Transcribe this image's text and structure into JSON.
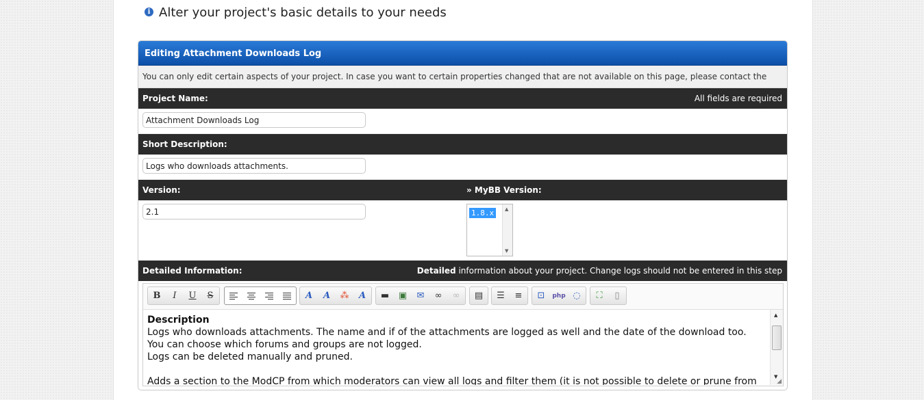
{
  "notice": {
    "icon": "info-icon",
    "text": "Alter your project's basic details to your needs"
  },
  "panel": {
    "title": "Editing Attachment Downloads Log",
    "note": "You can only edit certain aspects of your project. In case you want to certain properties changed that are not available on this page, please contact the Staff",
    "project_name": {
      "label": "Project Name:",
      "hint": "All fields are required",
      "value": "Attachment Downloads Log"
    },
    "short_description": {
      "label": "Short Description:",
      "value": "Logs who downloads attachments."
    },
    "version": {
      "label": "Version:",
      "value": "2.1"
    },
    "mybb_version": {
      "label": "» MyBB Version:",
      "selected": "1.8.x"
    },
    "detailed": {
      "label": "Detailed Information:",
      "hint_bold": "Detailed",
      "hint_rest": " information about your project. Change logs should not be entered in this step"
    }
  },
  "editor": {
    "toolbar_groups": [
      [
        "bold-icon",
        "italic-icon",
        "underline-icon",
        "strikethrough-icon"
      ],
      [
        "align-left-icon",
        "align-center-icon",
        "align-right-icon",
        "justify-icon"
      ],
      [
        "font-icon",
        "font-size-icon",
        "color-icon",
        "remove-format-icon"
      ],
      [
        "horizontal-rule-icon",
        "image-icon",
        "email-icon",
        "link-icon",
        "unlink-icon"
      ],
      [
        "video-icon"
      ],
      [
        "bullet-list-icon",
        "numbered-list-icon"
      ],
      [
        "code-icon",
        "php-icon",
        "quote-icon"
      ],
      [
        "maximize-icon",
        "source-icon"
      ]
    ],
    "content": {
      "heading": "Description",
      "lines": [
        "Logs who downloads attachments. The name and if of the attachments are logged as well and the date of the download too.",
        "You can choose which forums and groups are not logged.",
        "Logs can be deleted manually and pruned.",
        "",
        "Adds a section to the ModCP from which moderators can view all logs and filter them (it is not possible to delete or prune from ModCP)"
      ]
    }
  },
  "colors": {
    "header_blue": "#1463c4",
    "dark_bar": "#2b2b2b",
    "selection": "#3399ff"
  }
}
